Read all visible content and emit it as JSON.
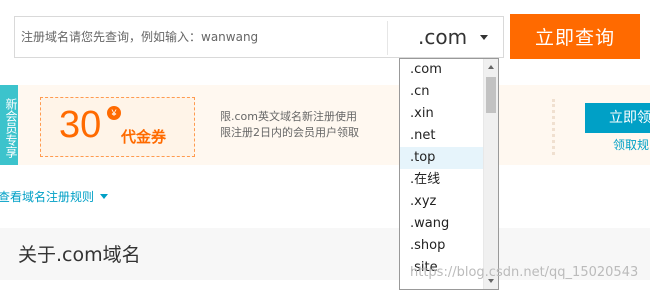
{
  "search": {
    "placeholder": "注册域名请您先查询，例如输入：wanwang",
    "value": "",
    "suffix": ".com",
    "button_label": "立即查询"
  },
  "promo": {
    "tag": "新会员专享",
    "coupon_amount": "30",
    "coupon_currency": "¥",
    "coupon_name": "代金券",
    "desc_line1": "限.com英文域名新注册使用",
    "desc_line2": "限注册2日内的会员用户领取",
    "claim_button": "立即领",
    "claim_link": "领取规"
  },
  "rules_link": "查看域名注册规则",
  "about_title": "关于.com域名",
  "dropdown": {
    "options": [
      ".com",
      ".cn",
      ".xin",
      ".net",
      ".top",
      ".在线",
      ".xyz",
      ".wang",
      ".shop",
      ".site"
    ],
    "highlighted": ".top"
  },
  "watermark": "https://blog.csdn.net/qq_15020543",
  "colors": {
    "accent_orange": "#ff6a00",
    "accent_blue": "#00a0c6",
    "tag_teal": "#3cc3cc"
  }
}
